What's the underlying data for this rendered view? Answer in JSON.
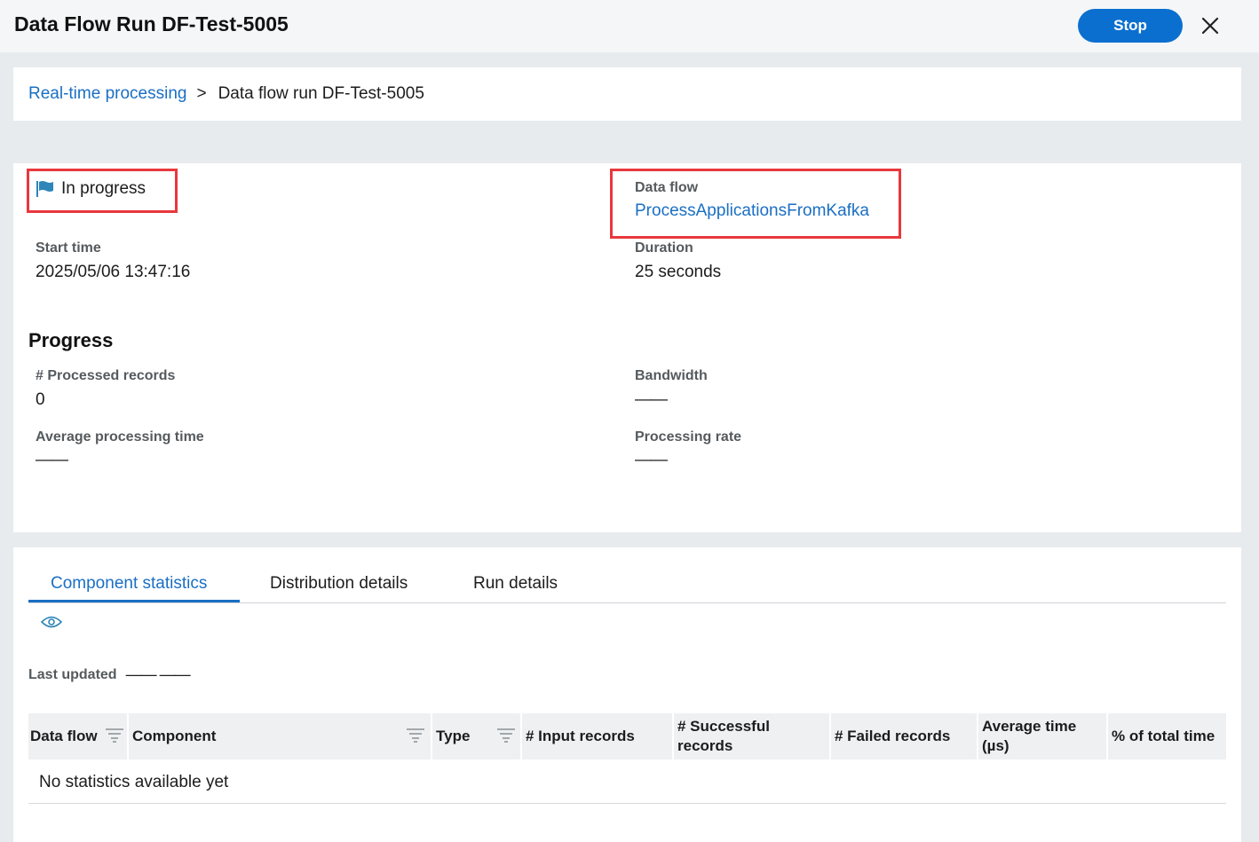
{
  "header": {
    "title": "Data Flow Run DF-Test-5005",
    "stop_label": "Stop"
  },
  "breadcrumb": {
    "parent": "Real-time processing",
    "separator": ">",
    "current": "Data flow run DF-Test-5005"
  },
  "run": {
    "status": "In progress",
    "data_flow_label": "Data flow",
    "data_flow_value": "ProcessApplicationsFromKafka",
    "start_time_label": "Start time",
    "start_time_value": "2025/05/06 13:47:16",
    "duration_label": "Duration",
    "duration_value": "25 seconds"
  },
  "progress": {
    "title": "Progress",
    "processed_label": "# Processed records",
    "processed_value": "0",
    "bandwidth_label": "Bandwidth",
    "bandwidth_value": "——",
    "avg_time_label": "Average processing time",
    "avg_time_value": "——",
    "rate_label": "Processing rate",
    "rate_value": "——"
  },
  "tabs": [
    {
      "label": "Component statistics",
      "active": true
    },
    {
      "label": "Distribution details",
      "active": false
    },
    {
      "label": "Run details",
      "active": false
    }
  ],
  "stats": {
    "last_updated_label": "Last updated",
    "last_updated_value": "——  ——",
    "columns": [
      "Data flow",
      "Component",
      "Type",
      "# Input records",
      "# Successful records",
      "# Failed records",
      "Average time (µs)",
      "% of total time"
    ],
    "empty_message": "No statistics available yet"
  },
  "colors": {
    "accent": "#1a6fc4",
    "button": "#0b6fd0",
    "highlight": "#e8383d",
    "flag": "#2e86b8"
  },
  "icons": {
    "close": "close-icon",
    "flag": "flag-icon",
    "eye": "eye-icon",
    "filter": "filter-icon"
  }
}
